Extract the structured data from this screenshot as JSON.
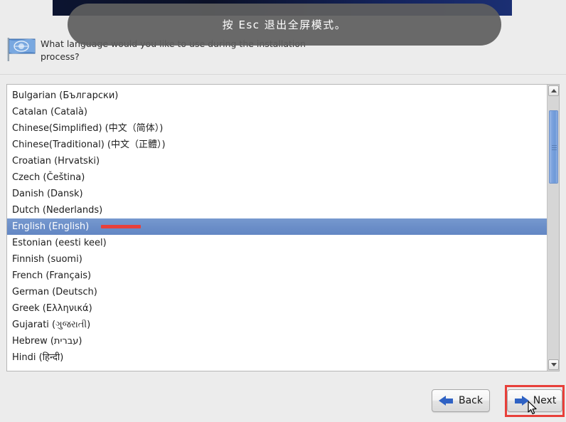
{
  "overlay": {
    "message": "按 Esc 退出全屏模式。",
    "icon": "fullscreen-exit-toast"
  },
  "header": {
    "icon": "language-flag-icon",
    "question": "What language would you like to use during the installation process?"
  },
  "language_list": {
    "selected": "English (English)",
    "items": [
      "Bulgarian (Български)",
      "Catalan (Català)",
      "Chinese(Simplified) (中文（简体）)",
      "Chinese(Traditional) (中文（正體）)",
      "Croatian (Hrvatski)",
      "Czech (Čeština)",
      "Danish (Dansk)",
      "Dutch (Nederlands)",
      "English (English)",
      "Estonian (eesti keel)",
      "Finnish (suomi)",
      "French (Français)",
      "German (Deutsch)",
      "Greek (Ελληνικά)",
      "Gujarati (ગુજરાતી)",
      "Hebrew (עברית)",
      "Hindi (हिन्दी)"
    ]
  },
  "scrollbar": {
    "up_icon": "chevron-up-icon",
    "down_icon": "chevron-down-icon",
    "orientation": "vertical"
  },
  "footer": {
    "back_label": "Back",
    "back_icon": "arrow-left-icon",
    "next_label": "Next",
    "next_icon": "arrow-right-icon"
  },
  "annotations": {
    "selected_row_marker_color": "#e8403a",
    "next_button_highlight_color": "#e8403a",
    "cursor": "mouse-pointer"
  },
  "colors": {
    "background": "#ececec",
    "titlebar": "#14245e",
    "selection": "#6b8ec8",
    "arrow_blue": "#2f62c4",
    "scroll_thumb": "#7ca3de"
  }
}
